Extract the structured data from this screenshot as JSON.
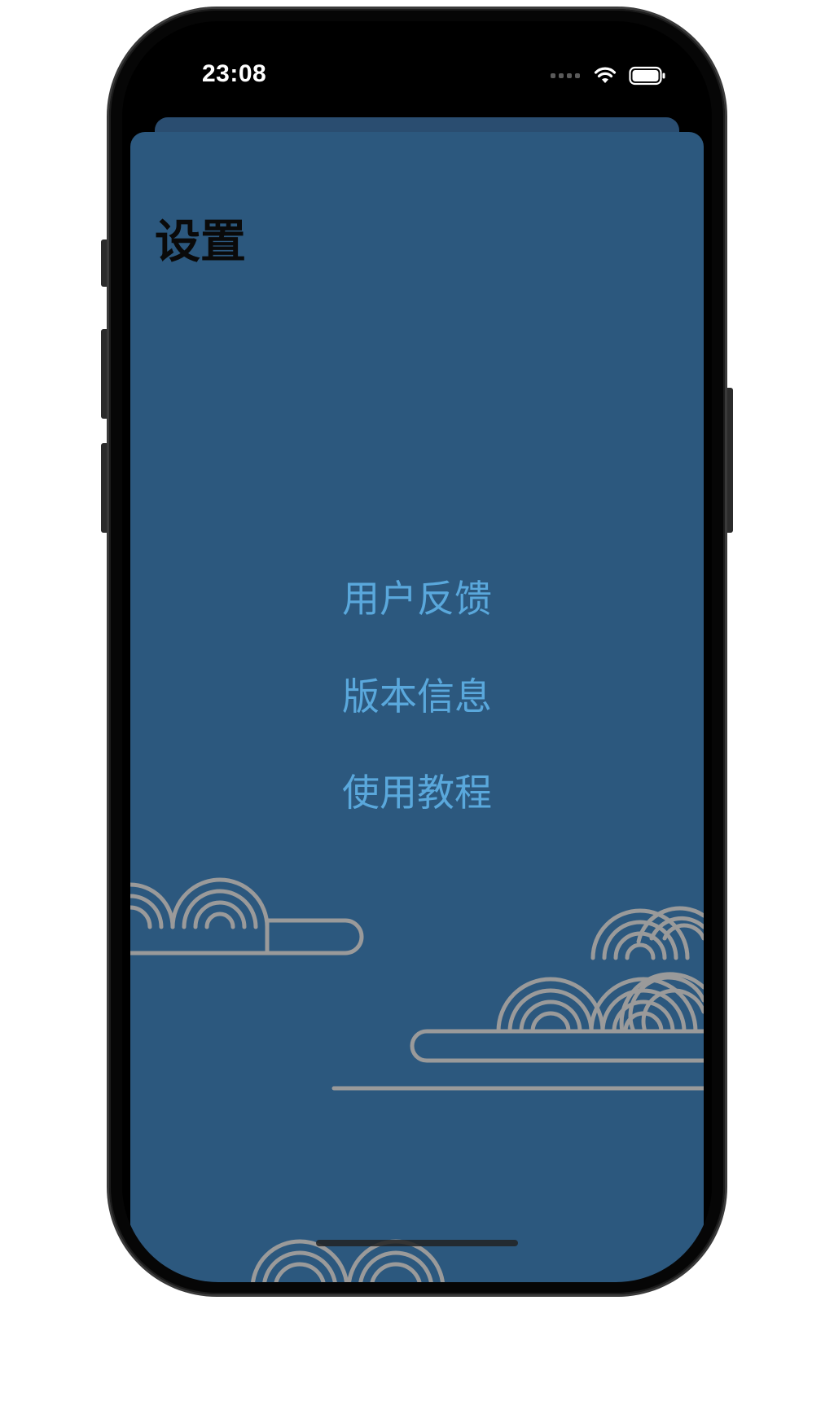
{
  "status_bar": {
    "time": "23:08",
    "signal_icon": "cellular-signal-icon",
    "wifi_icon": "wifi-icon",
    "battery_icon": "battery-icon"
  },
  "page": {
    "title": "设置"
  },
  "menu": {
    "items": [
      {
        "label": "用户反馈"
      },
      {
        "label": "版本信息"
      },
      {
        "label": "使用教程"
      }
    ]
  },
  "colors": {
    "sheet_background": "#2c587e",
    "menu_text": "#5aa8dc",
    "title_text": "#0a0a0a",
    "cloud_stroke": "#9a9a9a"
  },
  "decorations": {
    "pattern": "auspicious-cloud-pattern"
  }
}
